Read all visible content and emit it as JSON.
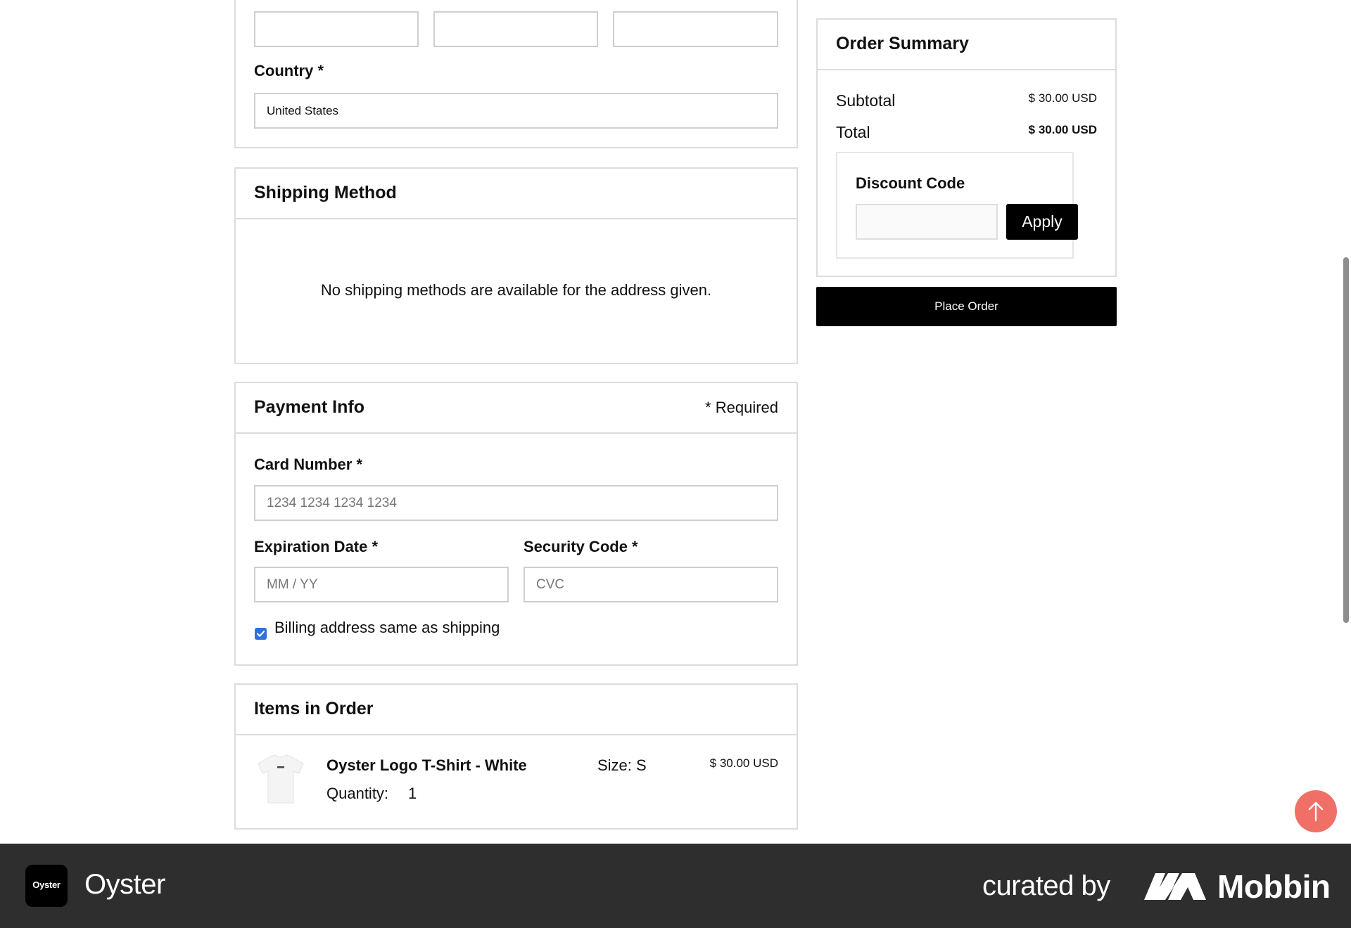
{
  "address": {
    "country_label": "Country *",
    "country_value": "United States"
  },
  "shipping": {
    "title": "Shipping Method",
    "message": "No shipping methods are available for the address given."
  },
  "payment": {
    "title": "Payment Info",
    "required_note": "* Required",
    "card_label": "Card Number *",
    "card_placeholder": "1234 1234 1234 1234",
    "exp_label": "Expiration Date *",
    "exp_placeholder": "MM / YY",
    "cvc_label": "Security Code *",
    "cvc_placeholder": "CVC",
    "billing_same_label": "Billing address same as shipping",
    "billing_same_checked": true
  },
  "items": {
    "title": "Items in Order",
    "list": [
      {
        "name": "Oyster Logo T-Shirt - White",
        "size": "Size: S",
        "price": "$ 30.00 USD",
        "quantity_label": "Quantity:",
        "quantity": "1"
      }
    ]
  },
  "summary": {
    "title": "Order Summary",
    "subtotal_label": "Subtotal",
    "subtotal_value": "$ 30.00 USD",
    "total_label": "Total",
    "total_value": "$ 30.00 USD",
    "discount_label": "Discount Code",
    "apply_label": "Apply",
    "place_order_label": "Place Order"
  },
  "footer": {
    "app_logo_text": "Oyster",
    "app_name": "Oyster",
    "curated_by": "curated by",
    "brand": "Mobbin"
  },
  "colors": {
    "accent_black": "#000000",
    "scroll_top_button": "#f07068",
    "footer_bg": "#2e2e2e",
    "checkbox": "#2f6fde"
  }
}
